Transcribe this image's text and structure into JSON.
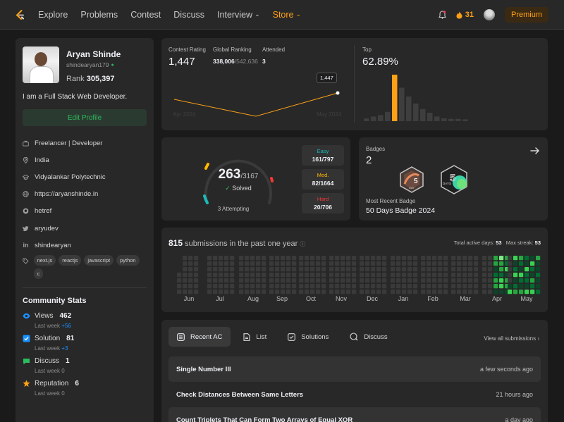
{
  "nav": {
    "links": [
      "Explore",
      "Problems",
      "Contest",
      "Discuss",
      "Interview",
      "Store"
    ],
    "streak_count": "31",
    "premium_label": "Premium"
  },
  "profile": {
    "name": "Aryan Shinde",
    "handle": "shindearyan179",
    "rank_label": "Rank",
    "rank_value": "305,397",
    "bio": "I am a Full Stack Web Developer.",
    "edit_label": "Edit Profile",
    "info": [
      {
        "icon": "briefcase-icon",
        "text": "Freelancer | Developer"
      },
      {
        "icon": "location-icon",
        "text": "India"
      },
      {
        "icon": "school-icon",
        "text": "Vidyalankar Polytechnic"
      },
      {
        "icon": "globe-icon",
        "text": "https://aryanshinde.in"
      },
      {
        "icon": "github-icon",
        "text": "hetref"
      },
      {
        "icon": "twitter-icon",
        "text": "aryudev"
      },
      {
        "icon": "linkedin-icon",
        "text": "shindearyan"
      }
    ],
    "tags": [
      "next.js",
      "reactjs",
      "javascript",
      "python",
      "c"
    ]
  },
  "community": {
    "title": "Community Stats",
    "items": [
      {
        "label": "Views",
        "value": "462",
        "sub_prefix": "Last week",
        "sub_value": "+56",
        "color": "#1a90ff"
      },
      {
        "label": "Solution",
        "value": "81",
        "sub_prefix": "Last week",
        "sub_value": "+3",
        "color": "#1a90ff"
      },
      {
        "label": "Discuss",
        "value": "1",
        "sub_prefix": "Last week",
        "sub_value": "0",
        "color": "#2cbb5d"
      },
      {
        "label": "Reputation",
        "value": "6",
        "sub_prefix": "Last week",
        "sub_value": "0",
        "color": "#ffa116"
      }
    ]
  },
  "rating": {
    "contest_label": "Contest Rating",
    "contest_value": "1,447",
    "global_label": "Global Ranking",
    "global_value": "338,006",
    "global_total": "/542,636",
    "attended_label": "Attended",
    "attended_value": "3",
    "tooltip": "1,447",
    "start_label": "Apr 2024",
    "end_label": "May 2024",
    "top_label": "Top",
    "top_value": "62.89%",
    "line_points": [
      0.45,
      0.05,
      0.6
    ],
    "histogram": [
      0.06,
      0.1,
      0.13,
      0.2,
      1.0,
      0.72,
      0.53,
      0.38,
      0.26,
      0.18,
      0.1,
      0.06,
      0.05,
      0.05,
      0.04
    ]
  },
  "solved": {
    "solved_value": "263",
    "total": "/3167",
    "solved_label": "Solved",
    "attempting_label": "3 Attempting",
    "difficulties": [
      {
        "label": "Easy",
        "value": "161/797",
        "color": "#1cbaba"
      },
      {
        "label": "Med.",
        "value": "82/1664",
        "color": "#ffb700"
      },
      {
        "label": "Hard",
        "value": "20/706",
        "color": "#f63737"
      }
    ]
  },
  "badges": {
    "label": "Badges",
    "count": "2",
    "recent_label": "Most Recent Badge",
    "recent_name": "50 Days Badge 2024",
    "badge_a_text": "5",
    "badge_a_sub": "DAY",
    "badge_b_sub": "DAYS"
  },
  "submissions": {
    "count": "815",
    "label": "submissions in the past one year",
    "active_label": "Total active days:",
    "active_value": "53",
    "streak_label": "Max streak:",
    "streak_value": "53",
    "months": [
      "Jun",
      "Jul",
      "Aug",
      "Sep",
      "Oct",
      "Nov",
      "Dec",
      "Jan",
      "Feb",
      "Mar",
      "Apr",
      "May"
    ]
  },
  "recent": {
    "tabs": [
      {
        "label": "Recent AC",
        "icon": "recent-ac-icon"
      },
      {
        "label": "List",
        "icon": "list-icon"
      },
      {
        "label": "Solutions",
        "icon": "solutions-icon"
      },
      {
        "label": "Discuss",
        "icon": "discuss-icon"
      }
    ],
    "view_all": "View all submissions",
    "rows": [
      {
        "title": "Single Number III",
        "when": "a few seconds ago"
      },
      {
        "title": "Check Distances Between Same Letters",
        "when": "21 hours ago"
      },
      {
        "title": "Count Triplets That Can Form Two Arrays of Equal XOR",
        "when": "a day ago"
      }
    ]
  }
}
